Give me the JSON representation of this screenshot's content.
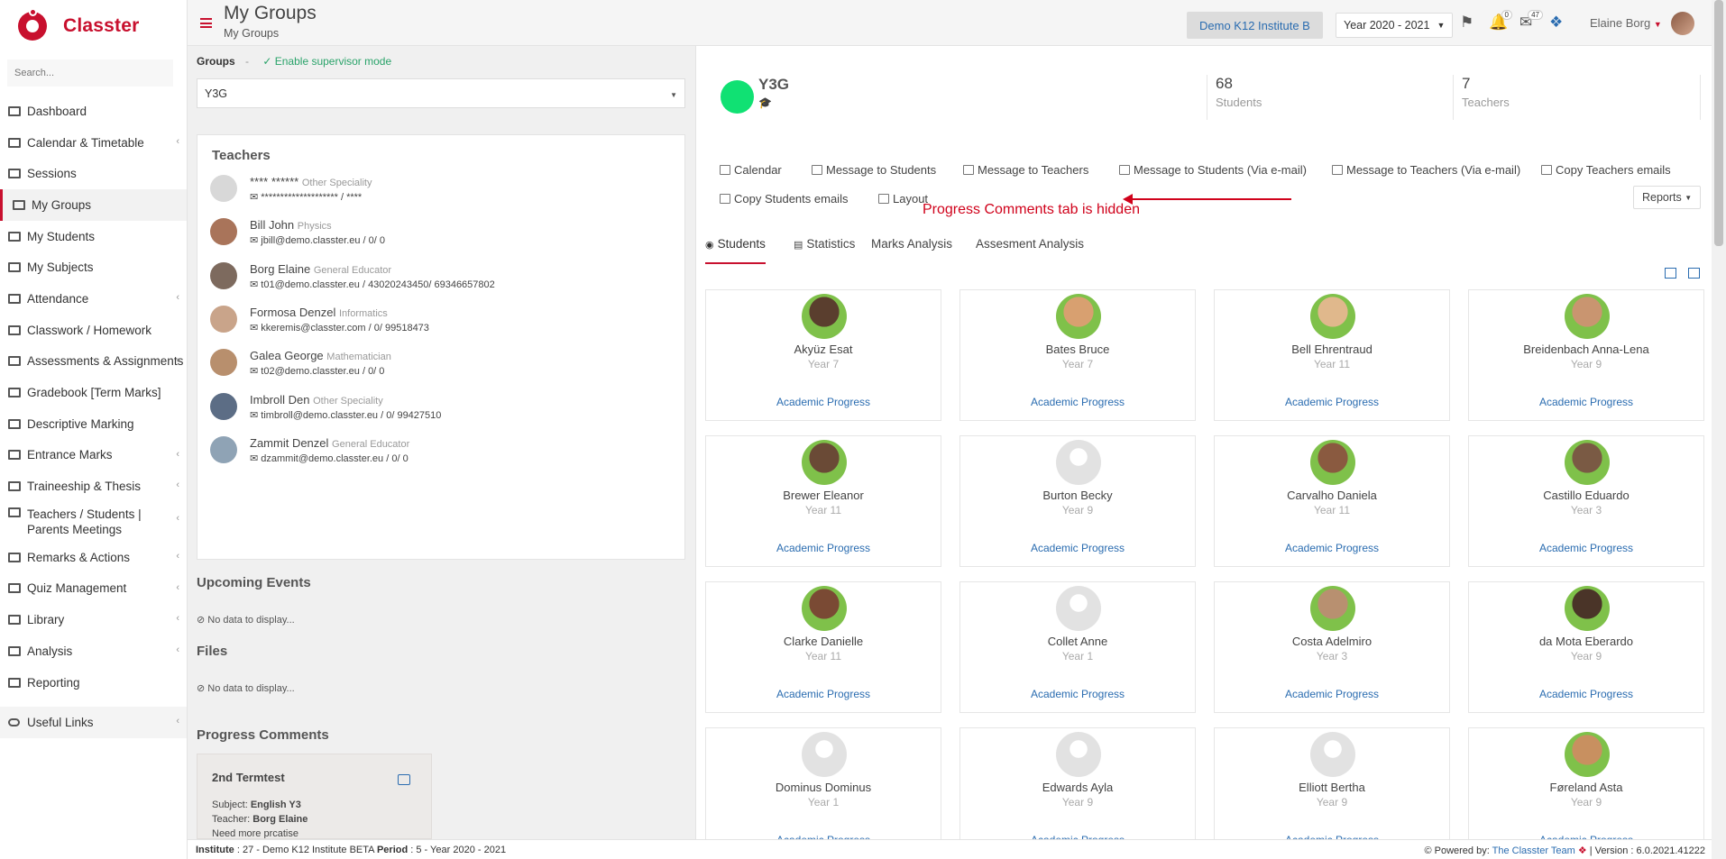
{
  "app": {
    "brand": "Classter",
    "search_placeholder": "Search..."
  },
  "sidebar": {
    "items": [
      {
        "label": "Dashboard",
        "chev": false,
        "icon": "laptop-icon"
      },
      {
        "label": "Calendar & Timetable",
        "chev": true,
        "icon": "calendar-icon"
      },
      {
        "label": "Sessions",
        "chev": false,
        "icon": "sessions-icon"
      },
      {
        "label": "My Groups",
        "chev": false,
        "icon": "group-icon",
        "active": true
      },
      {
        "label": "My Students",
        "chev": false,
        "icon": "users-icon"
      },
      {
        "label": "My Subjects",
        "chev": false,
        "icon": "book-icon"
      },
      {
        "label": "Attendance",
        "chev": true,
        "icon": "attendance-icon"
      },
      {
        "label": "Classwork / Homework",
        "chev": false,
        "icon": "list-icon"
      },
      {
        "label": "Assessments & Assignments",
        "chev": true,
        "icon": "edit-icon"
      },
      {
        "label": "Gradebook [Term Marks]",
        "chev": false,
        "icon": "gradebook-icon"
      },
      {
        "label": "Descriptive Marking",
        "chev": false,
        "icon": "marking-icon"
      },
      {
        "label": "Entrance Marks",
        "chev": true,
        "icon": "clipboard-icon"
      },
      {
        "label": "Traineeship & Thesis",
        "chev": true,
        "icon": "cube-icon"
      },
      {
        "label": "Teachers / Students | Parents Meetings",
        "chev": true,
        "icon": "meeting-icon",
        "two_line": true
      },
      {
        "label": "Remarks & Actions",
        "chev": true,
        "icon": "remarks-icon"
      },
      {
        "label": "Quiz Management",
        "chev": true,
        "icon": "quiz-icon"
      },
      {
        "label": "Library",
        "chev": true,
        "icon": "library-icon"
      },
      {
        "label": "Analysis",
        "chev": true,
        "icon": "analysis-icon"
      },
      {
        "label": "Reporting",
        "chev": false,
        "icon": "printer-icon"
      }
    ],
    "useful_links": "Useful Links"
  },
  "topbar": {
    "title": "My Groups",
    "subtitle": "My Groups",
    "institute": "Demo K12 Institute B",
    "year": "Year 2020 - 2021",
    "notif_badge": "0",
    "mail_badge": "47",
    "user": "Elaine Borg"
  },
  "left": {
    "groups_label": "Groups",
    "groups_dash": "-",
    "supervisor": "Enable supervisor mode",
    "selected_group": "Y3G",
    "teachers_title": "Teachers",
    "teachers": [
      {
        "name": "**** ******",
        "spec": "Other Speciality",
        "contact": "******************** / ****"
      },
      {
        "name": "Bill John",
        "spec": "Physics",
        "contact": "jbill@demo.classter.eu / 0/ 0"
      },
      {
        "name": "Borg Elaine",
        "spec": "General Educator",
        "contact": "t01@demo.classter.eu / 43020243450/ 69346657802"
      },
      {
        "name": "Formosa Denzel",
        "spec": "Informatics",
        "contact": "kkeremis@classter.com / 0/ 99518473"
      },
      {
        "name": "Galea George",
        "spec": "Mathematician",
        "contact": "t02@demo.classter.eu / 0/ 0"
      },
      {
        "name": "Imbroll Den",
        "spec": "Other Speciality",
        "contact": "timbroll@demo.classter.eu / 0/ 99427510"
      },
      {
        "name": "Zammit Denzel",
        "spec": "General Educator",
        "contact": "dzammit@demo.classter.eu / 0/ 0"
      }
    ],
    "upcoming_title": "Upcoming Events",
    "upcoming_empty": "No data to display...",
    "files_title": "Files",
    "files_empty": "No data to display...",
    "progress_title": "Progress Comments",
    "progress_card": {
      "title": "2nd Termtest",
      "subject_label": "Subject:",
      "subject": "English Y3",
      "teacher_label": "Teacher:",
      "teacher": "Borg Elaine",
      "note": "Need more prcatise"
    }
  },
  "right": {
    "group_name": "Y3G",
    "students_count": "68",
    "students_label": "Students",
    "teachers_count": "7",
    "teachers_label": "Teachers",
    "actions": [
      "Calendar",
      "Message to Students",
      "Message to Teachers",
      "Message to Students (Via e-mail)",
      "Message to Teachers (Via e-mail)",
      "Copy Teachers emails",
      "Copy Students emails",
      "Layout"
    ],
    "reports": "Reports",
    "annotation": "Progress Comments tab is hidden",
    "tabs": [
      "Students",
      "Statistics",
      "Marks Analysis",
      "Assesment Analysis"
    ],
    "academic_progress": "Academic Progress",
    "students": [
      {
        "name": "Akyüz Esat",
        "year": "Year 7",
        "photo": true
      },
      {
        "name": "Bates Bruce",
        "year": "Year 7",
        "photo": true
      },
      {
        "name": "Bell Ehrentraud",
        "year": "Year 11",
        "photo": true
      },
      {
        "name": "Breidenbach Anna-Lena",
        "year": "Year 9",
        "photo": true
      },
      {
        "name": "Brewer Eleanor",
        "year": "Year 11",
        "photo": true
      },
      {
        "name": "Burton Becky",
        "year": "Year 9",
        "photo": false
      },
      {
        "name": "Carvalho Daniela",
        "year": "Year 11",
        "photo": true
      },
      {
        "name": "Castillo Eduardo",
        "year": "Year 3",
        "photo": true
      },
      {
        "name": "Clarke Danielle",
        "year": "Year 11",
        "photo": true
      },
      {
        "name": "Collet Anne",
        "year": "Year 1",
        "photo": false
      },
      {
        "name": "Costa Adelmiro",
        "year": "Year 3",
        "photo": true
      },
      {
        "name": "da Mota Eberardo",
        "year": "Year 9",
        "photo": true
      },
      {
        "name": "Dominus Dominus",
        "year": "Year 1",
        "photo": false
      },
      {
        "name": "Edwards Ayla",
        "year": "Year 9",
        "photo": false
      },
      {
        "name": "Elliott Bertha",
        "year": "Year 9",
        "photo": false
      },
      {
        "name": "Føreland Asta",
        "year": "Year 9",
        "photo": true
      }
    ]
  },
  "footer": {
    "institute_label": "Institute",
    "institute": ": 27 - Demo K12 Institute BETA",
    "period_label": "Period",
    "period": ": 5 - Year 2020 - 2021",
    "powered": "Powered by:",
    "team": "The Classter Team",
    "version": "| Version : 6.0.2021.41222"
  }
}
